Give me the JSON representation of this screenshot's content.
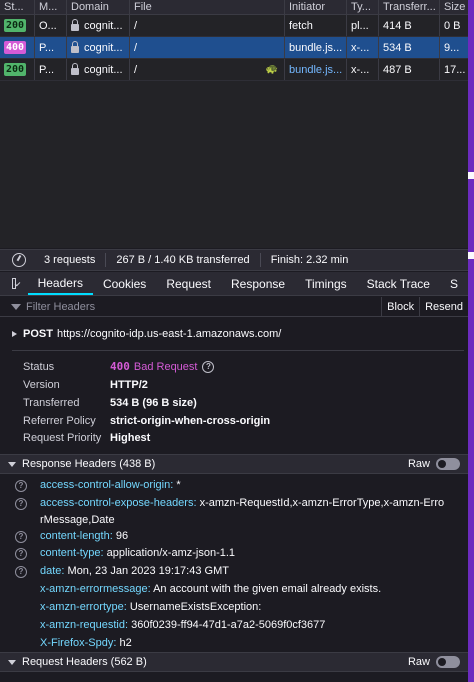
{
  "columns": [
    "St...",
    "M...",
    "Domain",
    "File",
    "Initiator",
    "Ty...",
    "Transferr...",
    "Size"
  ],
  "rows": [
    {
      "status": "200",
      "method": "O...",
      "domain": "cognit...",
      "file": "/",
      "initiator": "fetch",
      "type": "pl...",
      "transferred": "414 B",
      "size": "0 B"
    },
    {
      "status": "400",
      "method": "P...",
      "domain": "cognit...",
      "file": "/",
      "initiator": "bundle.js...",
      "type": "x-...",
      "transferred": "534 B",
      "size": "9..."
    },
    {
      "status": "200",
      "method": "P...",
      "domain": "cognit...",
      "file": "/",
      "initiator": "bundle.js...",
      "type": "x-...",
      "transferred": "487 B",
      "size": "17..."
    }
  ],
  "statusbar": {
    "requests": "3 requests",
    "transferred": "267 B / 1.40 KB transferred",
    "finish": "Finish: 2.32 min"
  },
  "tabs": [
    "Headers",
    "Cookies",
    "Request",
    "Response",
    "Timings",
    "Stack Trace",
    "S"
  ],
  "filter": {
    "placeholder": "Filter Headers",
    "block": "Block",
    "resend": "Resend"
  },
  "request": {
    "method": "POST",
    "url": "https://cognito-idp.us-east-1.amazonaws.com/"
  },
  "summary": {
    "status_label": "Status",
    "status_code": "400",
    "status_text": "Bad Request",
    "version_label": "Version",
    "version": "HTTP/2",
    "transferred_label": "Transferred",
    "transferred": "534 B (96 B size)",
    "referrer_label": "Referrer Policy",
    "referrer": "strict-origin-when-cross-origin",
    "priority_label": "Request Priority",
    "priority": "Highest"
  },
  "response_headers": {
    "title": "Response Headers (438 B)",
    "raw": "Raw",
    "items": [
      {
        "name": "access-control-allow-origin:",
        "value": "*"
      },
      {
        "name": "access-control-expose-headers:",
        "value": "x-amzn-RequestId,x-amzn-ErrorType,x-amzn-Erro",
        "value2": "rMessage,Date"
      },
      {
        "name": "content-length:",
        "value": "96"
      },
      {
        "name": "content-type:",
        "value": "application/x-amz-json-1.1"
      },
      {
        "name": "date:",
        "value": "Mon, 23 Jan 2023 19:17:43 GMT"
      },
      {
        "name": "x-amzn-errormessage:",
        "value": "An account with the given email already exists."
      },
      {
        "name": "x-amzn-errortype:",
        "value": "UsernameExistsException:"
      },
      {
        "name": "x-amzn-requestid:",
        "value": "360f0239-ff94-47d1-a7a2-5069f0cf3677"
      },
      {
        "name": "X-Firefox-Spdy:",
        "value": "h2"
      }
    ]
  },
  "request_headers": {
    "title": "Request Headers (562 B)",
    "raw": "Raw"
  },
  "colors": {
    "accent_tab": "#00ddff",
    "selected_row": "#1f4f8f",
    "error": "#d45bd6",
    "ok": "#51b46b",
    "edge": "#6c2bbf"
  }
}
